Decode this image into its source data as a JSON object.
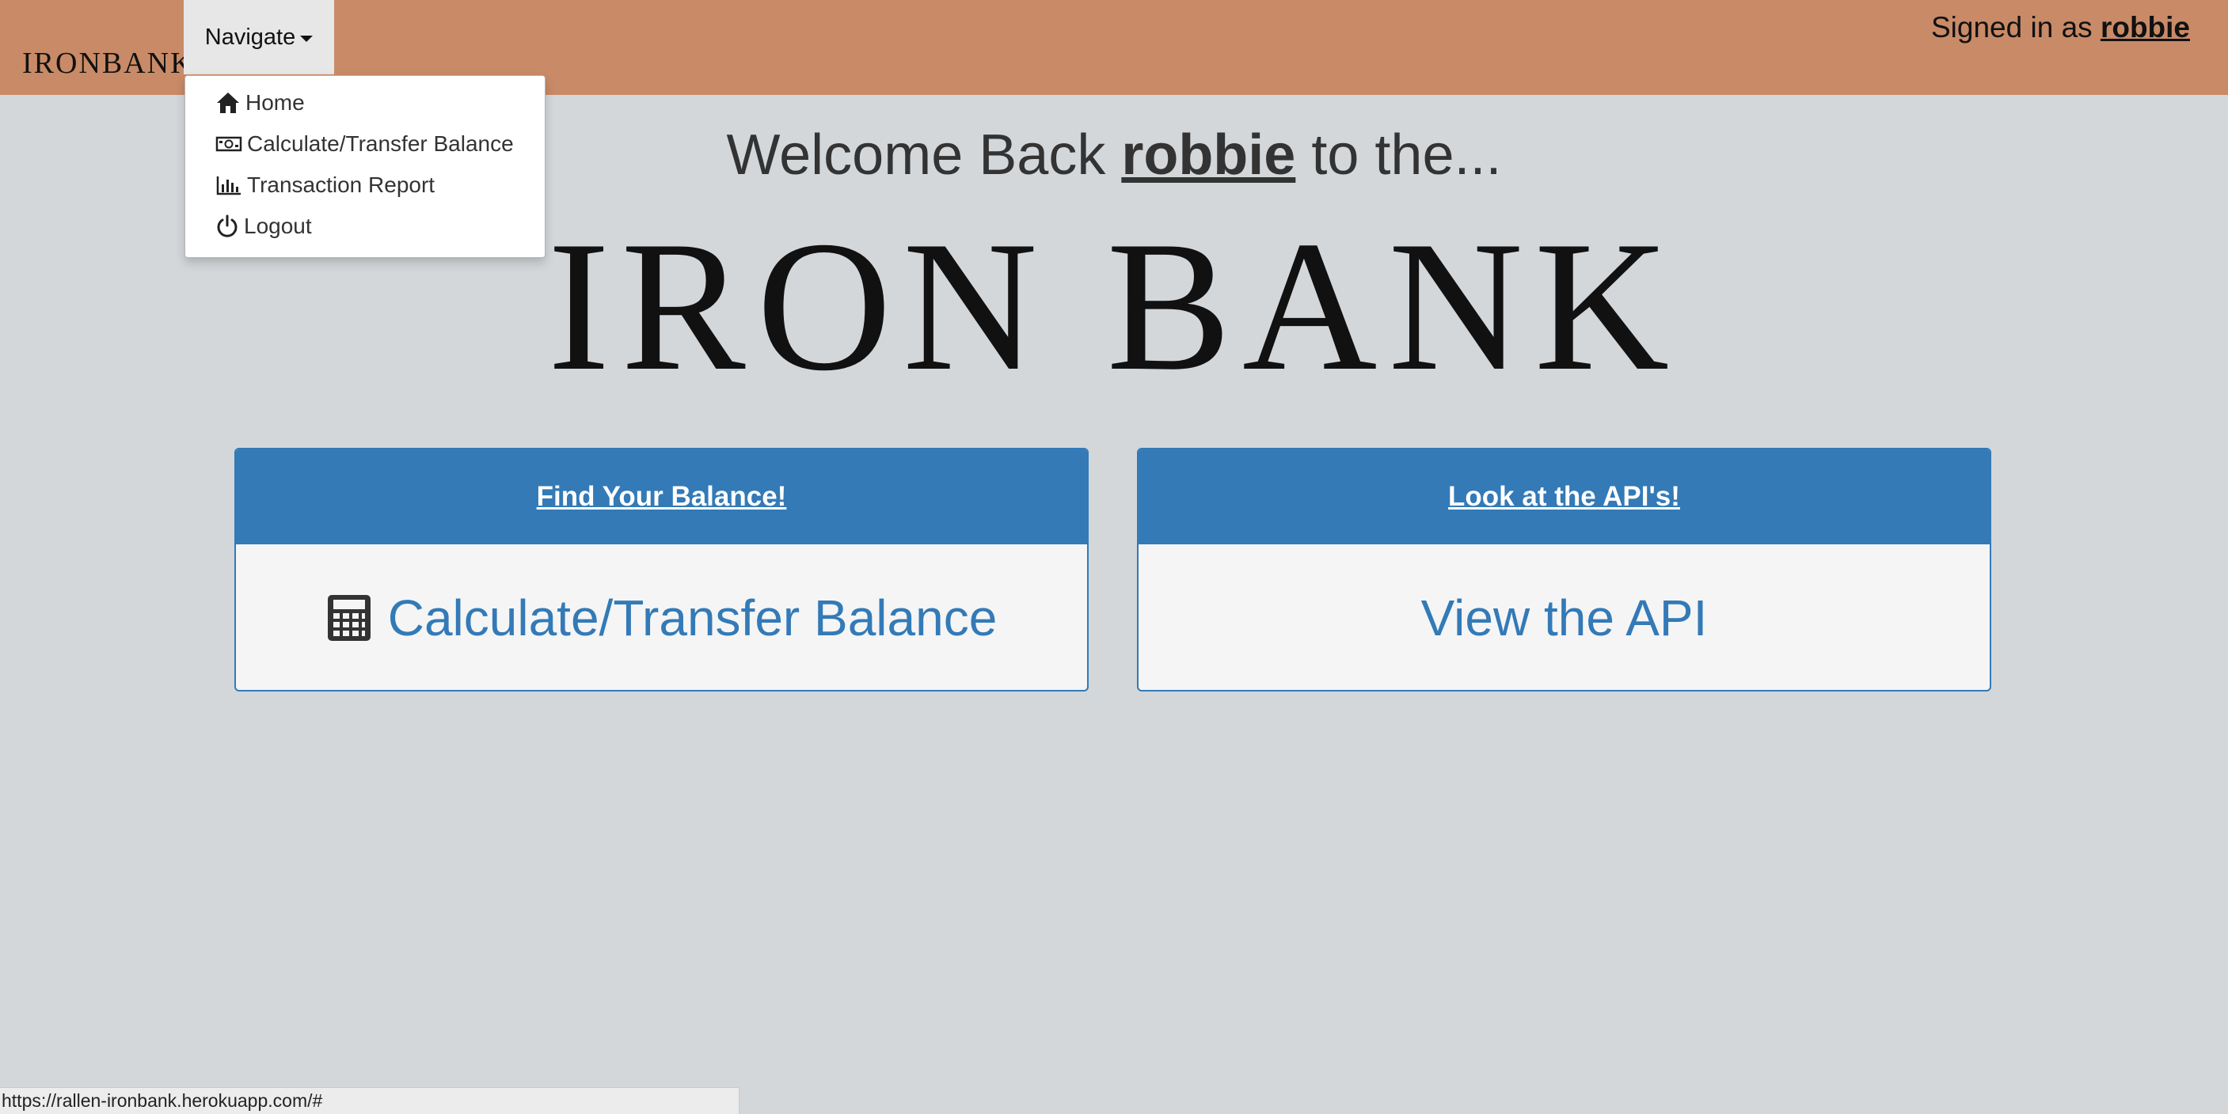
{
  "navbar": {
    "brand": "IRONBANK",
    "navigate_label": "Navigate",
    "signed_in_prefix": "Signed in as ",
    "signed_in_user": "robbie"
  },
  "menu": {
    "items": [
      {
        "label": "Home",
        "icon": "home-icon"
      },
      {
        "label": "Calculate/Transfer Balance",
        "icon": "money-icon"
      },
      {
        "label": "Transaction Report",
        "icon": "bar-chart-icon"
      },
      {
        "label": "Logout",
        "icon": "power-icon"
      }
    ]
  },
  "hero": {
    "welcome_prefix": "Welcome Back ",
    "welcome_user": "robbie",
    "welcome_suffix": " to the...",
    "logo_text": "IRON BANK"
  },
  "cards": {
    "left": {
      "header": "Find Your Balance!",
      "body": "Calculate/Transfer Balance",
      "icon": "calculator-icon"
    },
    "right": {
      "header": "Look at the API's!",
      "body": "View the API"
    }
  },
  "statusbar": {
    "url": "https://rallen-ironbank.herokuapp.com/#"
  },
  "colors": {
    "navbar": "#c98a67",
    "background": "#d3d7da",
    "primary": "#337ab7"
  }
}
